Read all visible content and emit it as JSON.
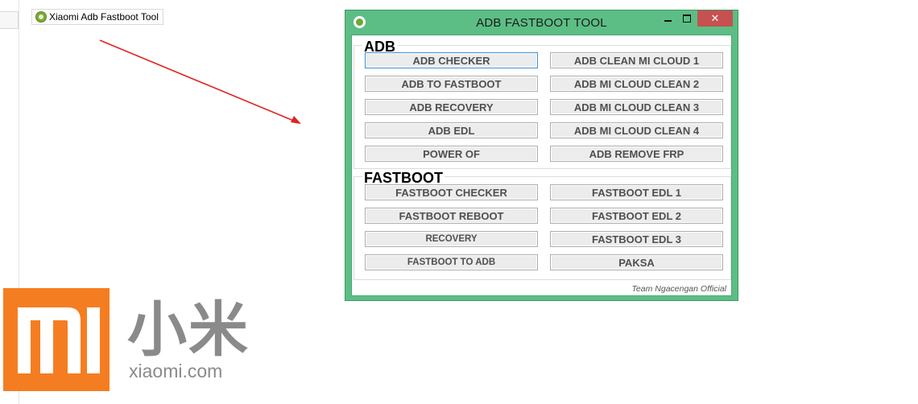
{
  "desktop": {
    "shortcut_label": "Xiaomi Adb Fastboot Tool",
    "arrow_color": "#e0231f"
  },
  "window": {
    "title": "ADB FASTBOOT TOOL",
    "close_glyph": "✕",
    "background": "#5cbe84",
    "adb_group": {
      "title": "ADB",
      "left_buttons": [
        "ADB CHECKER",
        "ADB TO FASTBOOT",
        "ADB RECOVERY",
        "ADB EDL",
        "POWER OF"
      ],
      "right_buttons": [
        "ADB CLEAN MI CLOUD 1",
        "ADB MI CLOUD CLEAN 2",
        "ADB MI CLOUD CLEAN 3",
        "ADB MI CLOUD CLEAN 4",
        "ADB REMOVE FRP"
      ]
    },
    "fastboot_group": {
      "title": "FASTBOOT",
      "left_buttons": [
        "FASTBOOT CHECKER",
        "FASTBOOT REBOOT",
        "RECOVERY",
        "FASTBOOT TO ADB"
      ],
      "right_buttons": [
        "FASTBOOT EDL 1",
        "FASTBOOT EDL 2",
        "FASTBOOT EDL 3",
        "PAKSA"
      ]
    },
    "footer": "Team Ngacengan Official"
  },
  "brand": {
    "logo_color": "#f57d21",
    "name_cn": "小米",
    "domain": "xiaomi.com"
  }
}
